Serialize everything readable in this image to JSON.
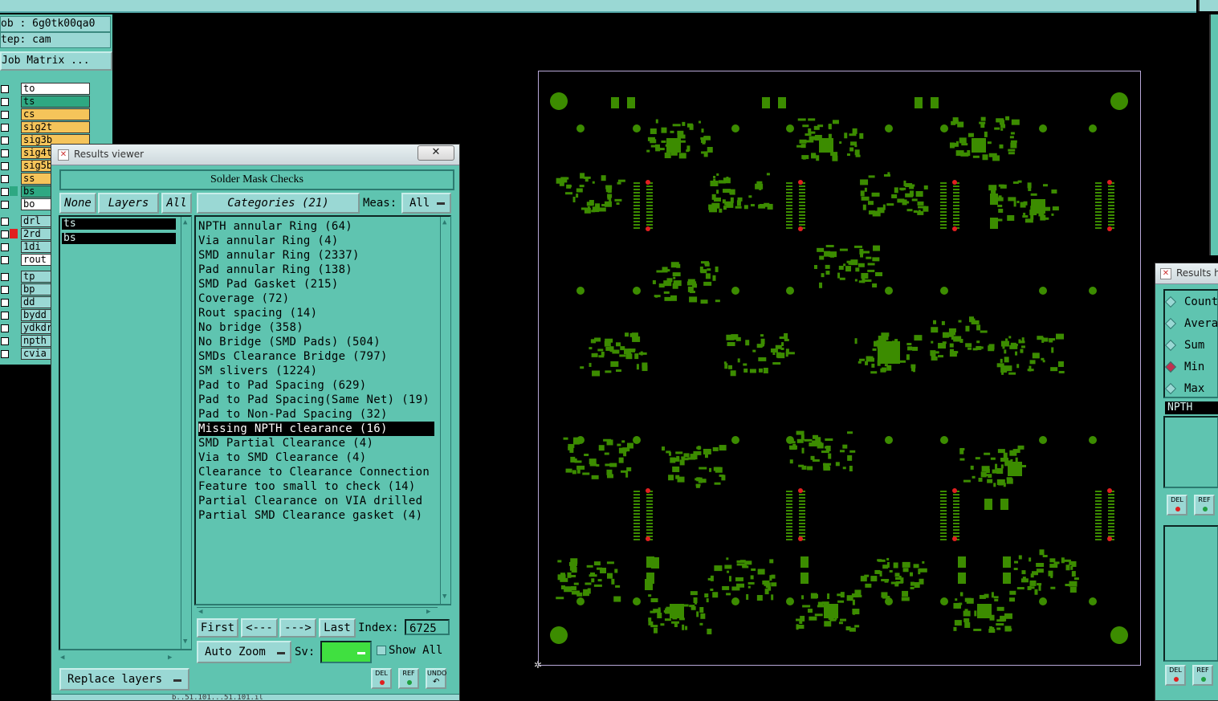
{
  "left": {
    "job": "ob : 6g0tk00qa0",
    "step": "tep: cam",
    "matrix_btn": "Job Matrix ...",
    "layers": [
      {
        "name": "to",
        "color": "#ffffff"
      },
      {
        "name": "ts",
        "color": "#2ea882"
      },
      {
        "name": "cs",
        "color": "#f5c45a"
      },
      {
        "name": "sig2t",
        "color": "#f5c45a"
      },
      {
        "name": "sig3b",
        "color": "#f5c45a"
      },
      {
        "name": "sig4t",
        "color": "#f5c45a"
      },
      {
        "name": "sig5b",
        "color": "#f5c45a"
      },
      {
        "name": "ss",
        "color": "#f5c45a"
      },
      {
        "name": "bs",
        "color": "#2ea882"
      },
      {
        "name": "bo",
        "color": "#ffffff"
      },
      {
        "name": "drl",
        "color": "#9ad8d4"
      },
      {
        "name": "2rd",
        "color": "#9ad8d4"
      },
      {
        "name": "1di",
        "color": "#9ad8d4"
      },
      {
        "name": "rout",
        "color": "#ffffff"
      },
      {
        "name": "tp",
        "color": "#9ad8d4"
      },
      {
        "name": "bp",
        "color": "#9ad8d4"
      },
      {
        "name": "dd",
        "color": "#9ad8d4"
      },
      {
        "name": "bydd",
        "color": "#9ad8d4"
      },
      {
        "name": "ydkdr",
        "color": "#9ad8d4"
      },
      {
        "name": "npth",
        "color": "#9ad8d4"
      },
      {
        "name": "cvia",
        "color": "#9ad8d4"
      }
    ]
  },
  "viewer": {
    "title": "Results viewer",
    "close_glyph": "✕",
    "header": "Solder Mask Checks",
    "none_btn": "None",
    "layers_btn": "Layers",
    "all_btn": "All",
    "categories_btn": "Categories (21)",
    "meas_label": "Meas:",
    "meas_value": "All",
    "selected_layers": [
      "ts",
      "bs"
    ],
    "categories": [
      "NPTH annular Ring (64)",
      "Via annular Ring (4)",
      "SMD annular Ring (2337)",
      "Pad annular Ring (138)",
      "SMD Pad Gasket (215)",
      "Coverage (72)",
      "Rout spacing (14)",
      "No bridge (358)",
      "No Bridge (SMD Pads) (504)",
      "SMDs Clearance Bridge (797)",
      "SM slivers (1224)",
      "Pad to Pad Spacing (629)",
      "Pad to Pad Spacing(Same Net) (19)",
      "Pad to Non-Pad Spacing (32)",
      "Missing NPTH clearance (16)",
      "SMD Partial Clearance (4)",
      "Via to SMD Clearance (4)",
      "Clearance to Clearance Connection",
      "Feature too small to check (14)",
      "Partial Clearance on VIA drilled",
      "Partial SMD Clearance gasket (4)"
    ],
    "selected_index": 14,
    "first_btn": "First",
    "prev_btn": "<---",
    "next_btn": "--->",
    "last_btn": "Last",
    "index_label": "Index:",
    "index_value": "6725",
    "auto_zoom": "Auto Zoom",
    "sv_label": "Sv:",
    "show_all": "Show All",
    "replace_layers": "Replace layers",
    "del": "DEL",
    "ref": "REF",
    "undo": "UNDO",
    "status_partial": "b..51.101...51.101.il"
  },
  "right": {
    "title": "Results h",
    "options": [
      "Count",
      "Avera",
      "Sum",
      "Min",
      "Max"
    ],
    "selected_option": "Min",
    "field_value": "NPTH",
    "del": "DEL",
    "ref": "REF"
  },
  "colors": {
    "panel": "#5fc4b0",
    "light": "#9ad8d4",
    "pcb": "#3c8c00",
    "marker": "#e02020",
    "selected_sv": "#40e040"
  }
}
